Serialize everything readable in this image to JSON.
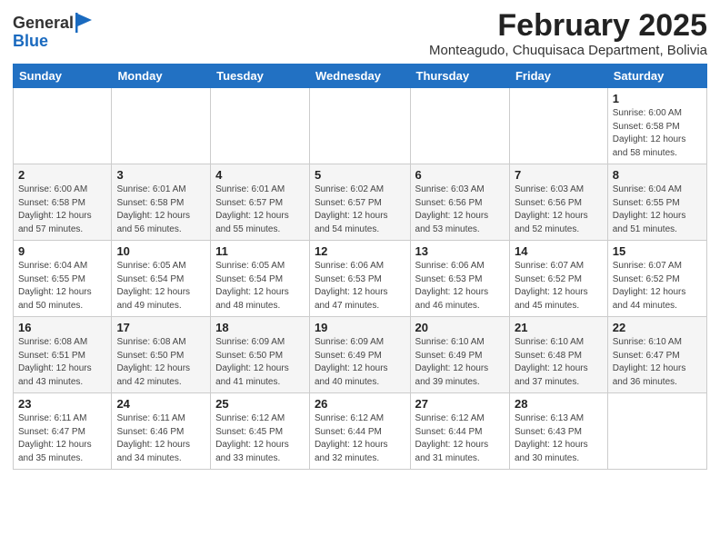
{
  "logo": {
    "general": "General",
    "blue": "Blue"
  },
  "title": "February 2025",
  "subtitle": "Monteagudo, Chuquisaca Department, Bolivia",
  "days_of_week": [
    "Sunday",
    "Monday",
    "Tuesday",
    "Wednesday",
    "Thursday",
    "Friday",
    "Saturday"
  ],
  "weeks": [
    [
      {
        "day": "",
        "info": ""
      },
      {
        "day": "",
        "info": ""
      },
      {
        "day": "",
        "info": ""
      },
      {
        "day": "",
        "info": ""
      },
      {
        "day": "",
        "info": ""
      },
      {
        "day": "",
        "info": ""
      },
      {
        "day": "1",
        "info": "Sunrise: 6:00 AM\nSunset: 6:58 PM\nDaylight: 12 hours\nand 58 minutes."
      }
    ],
    [
      {
        "day": "2",
        "info": "Sunrise: 6:00 AM\nSunset: 6:58 PM\nDaylight: 12 hours\nand 57 minutes."
      },
      {
        "day": "3",
        "info": "Sunrise: 6:01 AM\nSunset: 6:58 PM\nDaylight: 12 hours\nand 56 minutes."
      },
      {
        "day": "4",
        "info": "Sunrise: 6:01 AM\nSunset: 6:57 PM\nDaylight: 12 hours\nand 55 minutes."
      },
      {
        "day": "5",
        "info": "Sunrise: 6:02 AM\nSunset: 6:57 PM\nDaylight: 12 hours\nand 54 minutes."
      },
      {
        "day": "6",
        "info": "Sunrise: 6:03 AM\nSunset: 6:56 PM\nDaylight: 12 hours\nand 53 minutes."
      },
      {
        "day": "7",
        "info": "Sunrise: 6:03 AM\nSunset: 6:56 PM\nDaylight: 12 hours\nand 52 minutes."
      },
      {
        "day": "8",
        "info": "Sunrise: 6:04 AM\nSunset: 6:55 PM\nDaylight: 12 hours\nand 51 minutes."
      }
    ],
    [
      {
        "day": "9",
        "info": "Sunrise: 6:04 AM\nSunset: 6:55 PM\nDaylight: 12 hours\nand 50 minutes."
      },
      {
        "day": "10",
        "info": "Sunrise: 6:05 AM\nSunset: 6:54 PM\nDaylight: 12 hours\nand 49 minutes."
      },
      {
        "day": "11",
        "info": "Sunrise: 6:05 AM\nSunset: 6:54 PM\nDaylight: 12 hours\nand 48 minutes."
      },
      {
        "day": "12",
        "info": "Sunrise: 6:06 AM\nSunset: 6:53 PM\nDaylight: 12 hours\nand 47 minutes."
      },
      {
        "day": "13",
        "info": "Sunrise: 6:06 AM\nSunset: 6:53 PM\nDaylight: 12 hours\nand 46 minutes."
      },
      {
        "day": "14",
        "info": "Sunrise: 6:07 AM\nSunset: 6:52 PM\nDaylight: 12 hours\nand 45 minutes."
      },
      {
        "day": "15",
        "info": "Sunrise: 6:07 AM\nSunset: 6:52 PM\nDaylight: 12 hours\nand 44 minutes."
      }
    ],
    [
      {
        "day": "16",
        "info": "Sunrise: 6:08 AM\nSunset: 6:51 PM\nDaylight: 12 hours\nand 43 minutes."
      },
      {
        "day": "17",
        "info": "Sunrise: 6:08 AM\nSunset: 6:50 PM\nDaylight: 12 hours\nand 42 minutes."
      },
      {
        "day": "18",
        "info": "Sunrise: 6:09 AM\nSunset: 6:50 PM\nDaylight: 12 hours\nand 41 minutes."
      },
      {
        "day": "19",
        "info": "Sunrise: 6:09 AM\nSunset: 6:49 PM\nDaylight: 12 hours\nand 40 minutes."
      },
      {
        "day": "20",
        "info": "Sunrise: 6:10 AM\nSunset: 6:49 PM\nDaylight: 12 hours\nand 39 minutes."
      },
      {
        "day": "21",
        "info": "Sunrise: 6:10 AM\nSunset: 6:48 PM\nDaylight: 12 hours\nand 37 minutes."
      },
      {
        "day": "22",
        "info": "Sunrise: 6:10 AM\nSunset: 6:47 PM\nDaylight: 12 hours\nand 36 minutes."
      }
    ],
    [
      {
        "day": "23",
        "info": "Sunrise: 6:11 AM\nSunset: 6:47 PM\nDaylight: 12 hours\nand 35 minutes."
      },
      {
        "day": "24",
        "info": "Sunrise: 6:11 AM\nSunset: 6:46 PM\nDaylight: 12 hours\nand 34 minutes."
      },
      {
        "day": "25",
        "info": "Sunrise: 6:12 AM\nSunset: 6:45 PM\nDaylight: 12 hours\nand 33 minutes."
      },
      {
        "day": "26",
        "info": "Sunrise: 6:12 AM\nSunset: 6:44 PM\nDaylight: 12 hours\nand 32 minutes."
      },
      {
        "day": "27",
        "info": "Sunrise: 6:12 AM\nSunset: 6:44 PM\nDaylight: 12 hours\nand 31 minutes."
      },
      {
        "day": "28",
        "info": "Sunrise: 6:13 AM\nSunset: 6:43 PM\nDaylight: 12 hours\nand 30 minutes."
      },
      {
        "day": "",
        "info": ""
      }
    ]
  ]
}
